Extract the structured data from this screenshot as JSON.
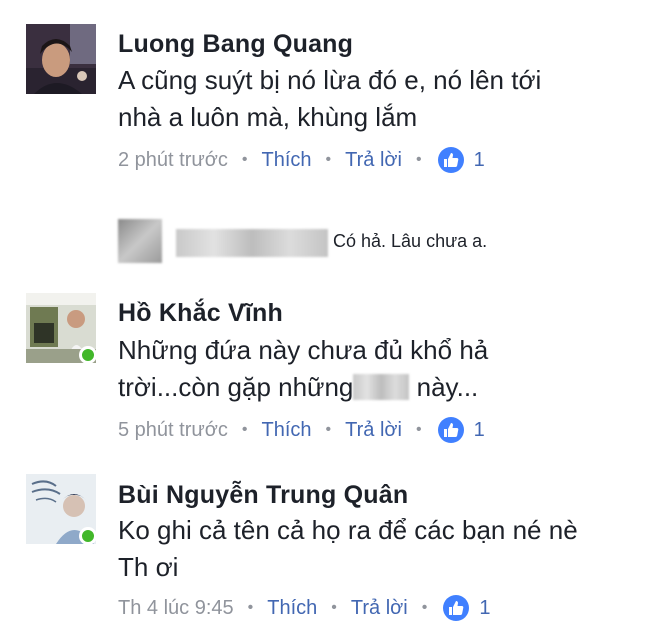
{
  "comments": [
    {
      "author": "Luong Bang Quang",
      "text_line1": "A cũng suýt bị nó lừa đó e, nó lên tới",
      "text_line2": "nhà a luôn mà, khùng lắm",
      "time": "2 phút trước",
      "like_label": "Thích",
      "reply_label": "Trả lời",
      "reactions": "1"
    },
    {
      "author": "Hồ Khắc Vĩnh",
      "text_line1": "Những đứa này chưa đủ khổ hả",
      "text_line2a": "trời...còn gặp những",
      "text_line2b": "này...",
      "time": "5 phút trước",
      "like_label": "Thích",
      "reply_label": "Trả lời",
      "reactions": "1"
    },
    {
      "author": "Bùi Nguyễn Trung Quân",
      "text_line1": "Ko ghi cả tên cả họ ra để các bạn né nè",
      "text_line2": "Th ơi",
      "time": "Th 4 lúc 9:45",
      "like_label": "Thích",
      "reply_label": "Trả lời",
      "reactions": "1"
    }
  ],
  "reply_preview": {
    "text": "Có hả. Lâu chưa a."
  },
  "colors": {
    "link": "#4267b2",
    "meta": "#90949c",
    "like_badge": "#4080ff",
    "online": "#42b72a"
  },
  "icons": {
    "like": "thumbs-up-icon",
    "online": "online-status-dot"
  }
}
